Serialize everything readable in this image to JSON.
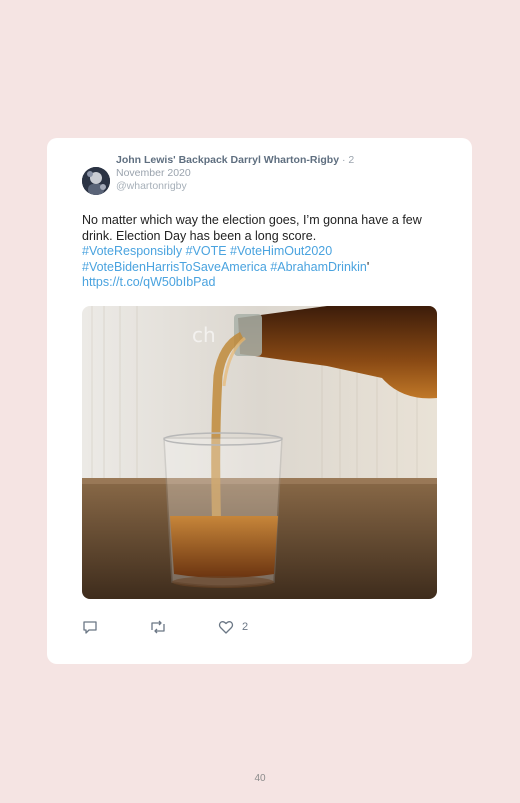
{
  "tweet": {
    "author_name": "John Lewis' Backpack Darryl Wharton-Rigby",
    "date_line1": "2",
    "date_line2": "November 2020",
    "handle": "@whartonrigby",
    "text_plain": "No matter which way the election goes, I’m gonna have a few drink. Election Day has been a long score.",
    "hashtags": [
      "#VoteResponsibly",
      "#VOTE",
      "#VoteHimOut2020",
      "#VoteBidenHarrisToSaveAmerica",
      "#AbrahamDrinkin"
    ],
    "link": "https://t.co/qW50bIbPad",
    "like_count": "2",
    "image_watermark": "ch",
    "icons": {
      "reply": "reply-icon",
      "retweet": "retweet-icon",
      "like": "heart-icon"
    }
  },
  "page": {
    "number": "40"
  },
  "colors": {
    "background": "#f5e4e3",
    "card": "#ffffff",
    "link": "#4aa3df",
    "author": "#5f6f80",
    "meta": "#9aa3ad"
  }
}
